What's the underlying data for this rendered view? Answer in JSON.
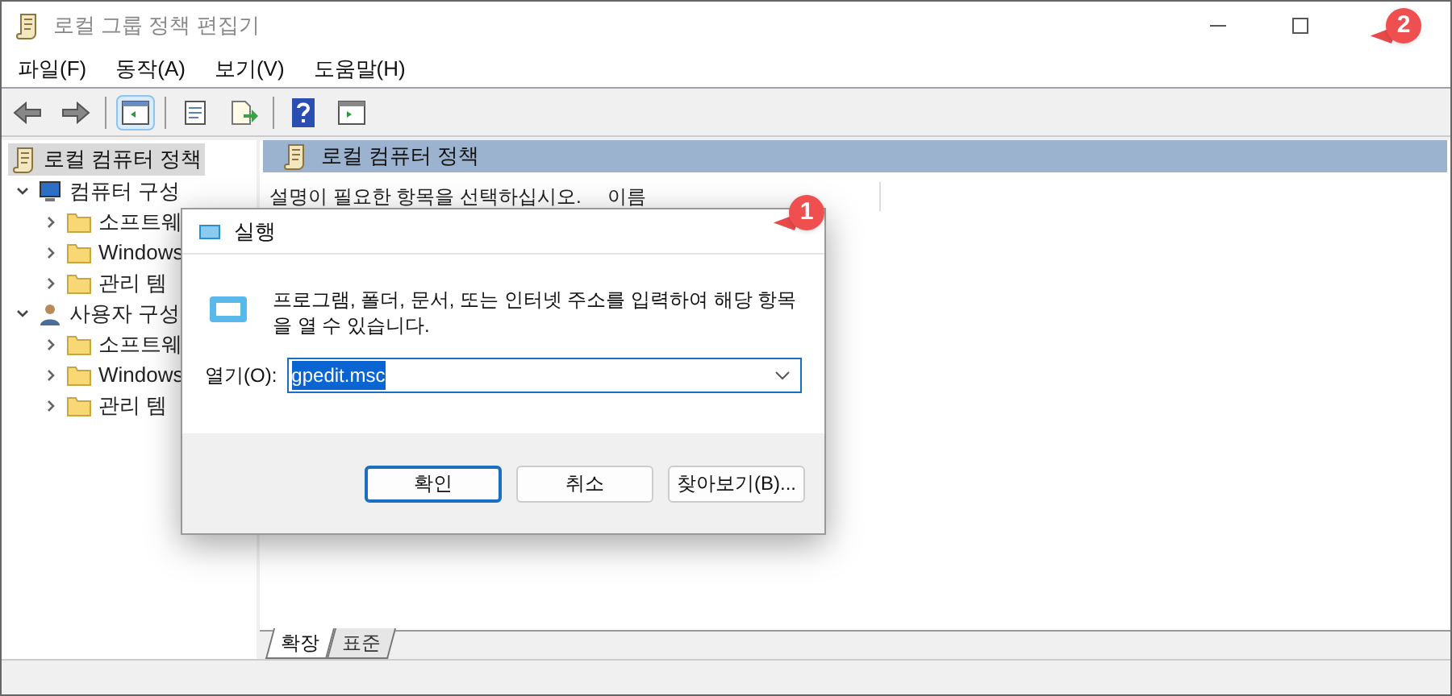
{
  "window": {
    "title": "로컬 그룹 정책 편집기"
  },
  "menu": [
    "파일(F)",
    "동작(A)",
    "보기(V)",
    "도움말(H)"
  ],
  "toolbar": [
    {
      "kind": "back"
    },
    {
      "kind": "forward"
    },
    {
      "kind": "sep"
    },
    {
      "kind": "tree",
      "selected": true
    },
    {
      "kind": "sep"
    },
    {
      "kind": "props",
      "selected": false
    },
    {
      "kind": "export",
      "selected": false
    },
    {
      "kind": "sep"
    },
    {
      "kind": "help",
      "selected": false
    },
    {
      "kind": "pane",
      "selected": false
    }
  ],
  "tree": {
    "label": "로컬 컴퓨터 정책",
    "selected": true,
    "children": [
      {
        "label": "컴퓨터 구성",
        "kind": "computer",
        "expanded": true,
        "children": [
          {
            "label": "소프트웨"
          },
          {
            "label": "Windows"
          },
          {
            "label": "관리 템"
          }
        ]
      },
      {
        "label": "사용자 구성",
        "kind": "user",
        "expanded": true,
        "children": [
          {
            "label": "소프트웨"
          },
          {
            "label": "Windows"
          },
          {
            "label": "관리 템"
          }
        ]
      }
    ]
  },
  "pane": {
    "header": "로컬 컴퓨터 정책",
    "description": "설명이 필요한 항목을 선택하십시오.",
    "column_1": "이름"
  },
  "view_tabs": [
    {
      "label": "확장",
      "selected": true
    },
    {
      "label": "표준",
      "selected": false
    }
  ],
  "run_dialog": {
    "title": "실행",
    "message": "프로그램, 폴더, 문서, 또는 인터넷 주소를 입력하여 해당 항목을 열 수 있습니다.",
    "open_label": "열기(O):",
    "open_value": "gpedit.msc",
    "buttons": [
      {
        "label": "확인",
        "selected": true
      },
      {
        "label": "취소",
        "selected": false
      },
      {
        "label": "찾아보기(B)...",
        "selected": false
      }
    ]
  },
  "annotations": [
    "1",
    "2"
  ]
}
